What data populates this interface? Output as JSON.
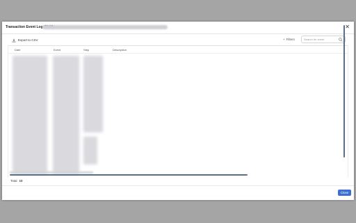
{
  "modal": {
    "title": "Transaction Event Log (Skill)",
    "close_icon": "close-icon"
  },
  "toolbar": {
    "export_label": "Export to CSV",
    "export_icon": "download-icon",
    "filters_label": "Filters",
    "filters_icon": "filter-icon",
    "search_placeholder": "Search for event",
    "search_icon": "search-icon"
  },
  "table": {
    "columns": [
      "Date",
      "Event",
      "Step",
      "Description"
    ]
  },
  "footer": {
    "total_label": "Total",
    "total_count": "10",
    "close_label": "Close"
  },
  "colors": {
    "primary": "#3b6fd4",
    "scrollbar": "#5a6e86"
  }
}
